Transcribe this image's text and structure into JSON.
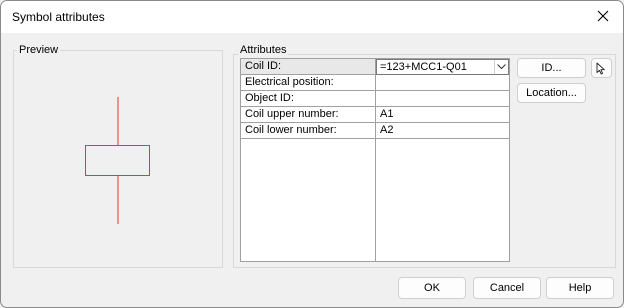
{
  "window": {
    "title": "Symbol attributes"
  },
  "preview": {
    "label": "Preview",
    "symbol_color": "#e53935"
  },
  "attributes": {
    "label": "Attributes",
    "rows": [
      {
        "name": "Coil ID:",
        "value": "=123+MCC1-Q01",
        "editor": "dropdown"
      },
      {
        "name": "Electrical position:",
        "value": ""
      },
      {
        "name": "Object ID:",
        "value": ""
      },
      {
        "name": "Coil upper number:",
        "value": "A1"
      },
      {
        "name": "Coil lower number:",
        "value": "A2"
      }
    ]
  },
  "side_buttons": {
    "id": "ID...",
    "location": "Location...",
    "pick_icon": "cursor-arrow-icon"
  },
  "footer": {
    "ok": "OK",
    "cancel": "Cancel",
    "help": "Help"
  }
}
